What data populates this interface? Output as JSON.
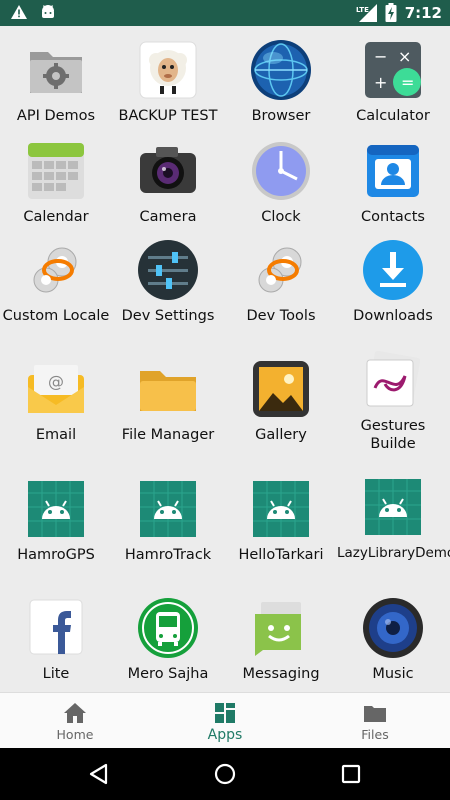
{
  "status_bar": {
    "time": "7:12",
    "network": "LTE",
    "icons": [
      "warning-icon",
      "android-notification-icon",
      "signal-icon",
      "battery-charging-icon"
    ]
  },
  "apps": [
    {
      "label": "API Demos",
      "icon": "folder-gear-icon"
    },
    {
      "label": "BACKUP TEST",
      "icon": "sheep-icon"
    },
    {
      "label": "Browser",
      "icon": "globe-icon"
    },
    {
      "label": "Calculator",
      "icon": "calculator-icon"
    },
    {
      "label": "Calendar",
      "icon": "calendar-icon"
    },
    {
      "label": "Camera",
      "icon": "camera-icon"
    },
    {
      "label": "Clock",
      "icon": "clock-icon"
    },
    {
      "label": "Contacts",
      "icon": "contacts-icon"
    },
    {
      "label": "Custom Locale",
      "icon": "gear-icon"
    },
    {
      "label": "Dev Settings",
      "icon": "sliders-icon"
    },
    {
      "label": "Dev Tools",
      "icon": "gear-icon"
    },
    {
      "label": "Downloads",
      "icon": "download-icon"
    },
    {
      "label": "Email",
      "icon": "email-icon"
    },
    {
      "label": "File Manager",
      "icon": "folder-icon"
    },
    {
      "label": "Gallery",
      "icon": "gallery-icon"
    },
    {
      "label": "Gestures Builde",
      "icon": "gestures-icon"
    },
    {
      "label": "HamroGPS",
      "icon": "android-icon"
    },
    {
      "label": "HamroTrack",
      "icon": "android-icon"
    },
    {
      "label": "HelloTarkari",
      "icon": "android-icon"
    },
    {
      "label": "LazyLibraryDemo",
      "icon": "android-icon"
    },
    {
      "label": "Lite",
      "icon": "facebook-icon"
    },
    {
      "label": "Mero Sajha",
      "icon": "bus-icon"
    },
    {
      "label": "Messaging",
      "icon": "messaging-icon"
    },
    {
      "label": "Music",
      "icon": "speaker-icon"
    }
  ],
  "bottom_nav": {
    "home": "Home",
    "apps": "Apps",
    "files": "Files",
    "active": "apps"
  },
  "colors": {
    "status_bar": "#1f5d4c",
    "accent": "#1f7a66",
    "android_teal": "#1d8a76"
  }
}
